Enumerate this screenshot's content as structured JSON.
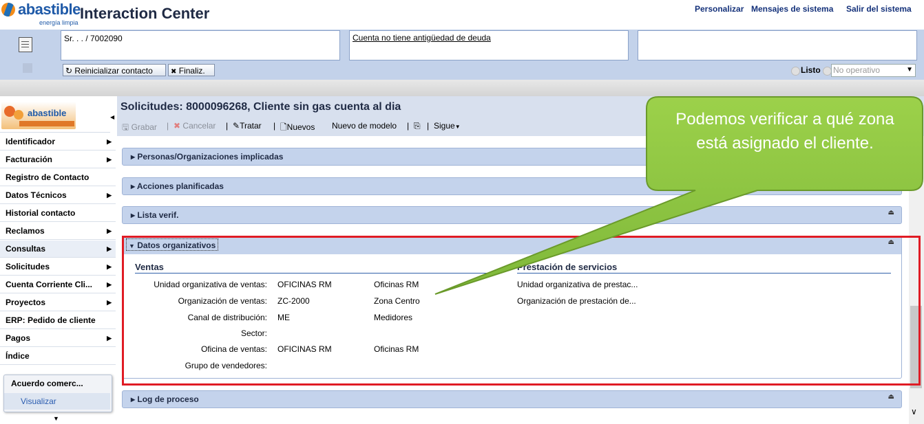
{
  "brand": {
    "name": "abastible",
    "tagline": "energía limpia",
    "app_title": "Interaction Center"
  },
  "top_links": [
    "Personalizar",
    "Mensajes de sistema",
    "Salir del sistema"
  ],
  "context": {
    "customer_text": "Sr. . . / 7002090",
    "debt_link": "Cuenta no tiene antigüedad de deuda",
    "reset_button": "Reinicializar contacto",
    "finish_button": "Finaliz.",
    "status_ready": "Listo",
    "status_select": "No operativo"
  },
  "nav": {
    "logo_text": "abastible",
    "items": [
      {
        "label": "Identificador",
        "arrow": true
      },
      {
        "label": "Facturación",
        "arrow": true
      },
      {
        "label": "Registro de Contacto",
        "arrow": false
      },
      {
        "label": "Datos Técnicos",
        "arrow": true
      },
      {
        "label": "Historial contacto",
        "arrow": false
      },
      {
        "label": "Reclamos",
        "arrow": true
      },
      {
        "label": "Consultas",
        "arrow": true
      },
      {
        "label": "Solicitudes",
        "arrow": true
      },
      {
        "label": "Cuenta Corriente Cli...",
        "arrow": true
      },
      {
        "label": "Proyectos",
        "arrow": true
      },
      {
        "label": "ERP: Pedido de cliente",
        "arrow": false
      },
      {
        "label": "Pagos",
        "arrow": true
      },
      {
        "label": "Índice",
        "arrow": false
      }
    ],
    "panel_title": "Acuerdo comerc...",
    "panel_link": "Visualizar"
  },
  "main": {
    "title": "Solicitudes: 8000096268, Cliente sin gas cuenta al dia",
    "toolbar": {
      "save": "Grabar",
      "cancel": "Cancelar",
      "edit": "Tratar",
      "new": "Nuevos",
      "new_model": "Nuevo de modelo",
      "next": "Sigue"
    },
    "sections": {
      "persons": "Personas/Organizaciones implicadas",
      "actions": "Acciones planificadas",
      "checklist": "Lista verif.",
      "org": "Datos organizativos",
      "log": "Log de proceso"
    },
    "sales": {
      "title": "Ventas",
      "rows": [
        {
          "label": "Unidad organizativa de ventas:",
          "code": "OFICINAS RM",
          "desc": "Oficinas RM"
        },
        {
          "label": "Organización de ventas:",
          "code": "ZC-2000",
          "desc": "Zona Centro"
        },
        {
          "label": "Canal de distribución:",
          "code": "ME",
          "desc": "Medidores"
        },
        {
          "label": "Sector:",
          "code": "",
          "desc": ""
        },
        {
          "label": "Oficina de ventas:",
          "code": "OFICINAS RM",
          "desc": "Oficinas RM"
        },
        {
          "label": "Grupo de vendedores:",
          "code": "",
          "desc": ""
        }
      ]
    },
    "services": {
      "title": "Prestación de servicios",
      "rows": [
        "Unidad organizativa de prestac...",
        "Organización de prestación de..."
      ]
    }
  },
  "callout": {
    "text": "Podemos verificar a qué zona está asignado el cliente."
  },
  "colors": {
    "accent_green": "#8dc63f",
    "highlight_red": "#e01b24",
    "brand_blue": "#1f5aa8"
  }
}
